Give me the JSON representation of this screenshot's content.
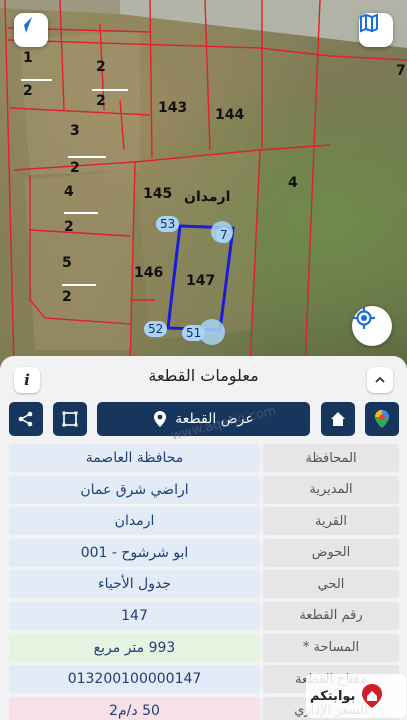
{
  "map": {
    "parcels": [
      {
        "id": "p1",
        "label": "1"
      },
      {
        "id": "p2a",
        "label": "2"
      },
      {
        "id": "p2b",
        "label": "2"
      },
      {
        "id": "p2c",
        "label": "2"
      },
      {
        "id": "p2d",
        "label": "2"
      },
      {
        "id": "p3",
        "label": "3"
      },
      {
        "id": "p2e",
        "label": "2"
      },
      {
        "id": "p4a",
        "label": "4"
      },
      {
        "id": "p2f",
        "label": "2"
      },
      {
        "id": "p5",
        "label": "5"
      },
      {
        "id": "p2g",
        "label": "2"
      },
      {
        "id": "p143",
        "label": "143"
      },
      {
        "id": "p144",
        "label": "144"
      },
      {
        "id": "p145",
        "label": "145"
      },
      {
        "id": "p146",
        "label": "146"
      },
      {
        "id": "p147",
        "label": "147"
      },
      {
        "id": "p4b",
        "label": "4"
      },
      {
        "id": "p7",
        "label": "7"
      }
    ],
    "area_label": "ارمدان",
    "points": [
      "53",
      "7",
      "52",
      "51"
    ],
    "accent_red": "#e0202a",
    "selection_blue": "#1c1cd6"
  },
  "sheet": {
    "title": "معلومات القطعة",
    "toolbar": {
      "view_parcel": "عرض القطعة"
    },
    "watermark": "www.aqarjo.com",
    "rows": [
      {
        "label": "المحافظة",
        "value": "محافظة العاصمة"
      },
      {
        "label": "المديرية",
        "value": "اراضي شرق عمان"
      },
      {
        "label": "القرية",
        "value": "ارمدان"
      },
      {
        "label": "الحوض",
        "value": "ابو شرشوح - 001"
      },
      {
        "label": "الحي",
        "value": "جدول الأحياء"
      },
      {
        "label": "رقم القطعة",
        "value": "147"
      },
      {
        "label": "المساحة *",
        "value": "993   متر مربع"
      },
      {
        "label": "مفتاح القطعة",
        "value": "013200100000147"
      },
      {
        "label": "السعر الإداري",
        "value": "50 د/م2"
      }
    ],
    "logo_text": "بوابتكم"
  },
  "colors": {
    "navy": "#16365e",
    "value_bg": "#e3ebf6",
    "value_text": "#1f3f78",
    "area_bg": "#e5f3e1",
    "price_bg": "#f8e1e6"
  }
}
